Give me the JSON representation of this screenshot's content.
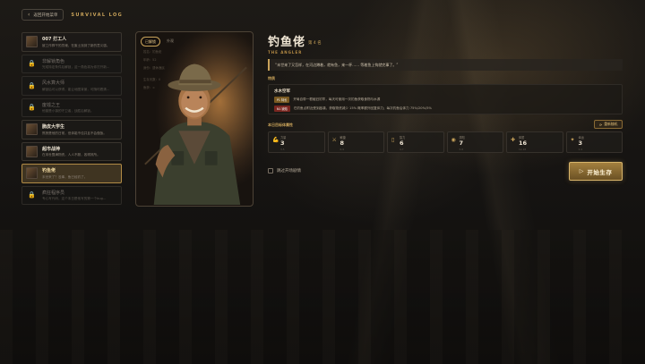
{
  "header": {
    "back_label": "返回开始菜单",
    "log_title": "SURVIVAL LOG"
  },
  "sidebar": {
    "items": [
      {
        "name": "007 打工人",
        "desc": "被工作榨干的灵魂，在废土找到了新的意义感。",
        "state": "normal"
      },
      {
        "name": "非解锁角色",
        "desc": "完成特定条件后解锁，这一角色将为你打开新…",
        "state": "locked"
      },
      {
        "name": "风水算大师",
        "desc": "解锁后可以获得，能让地图背景，可随时看清…",
        "state": "locked"
      },
      {
        "name": "废墟之王",
        "desc": "他曾是小镇的守卫者，战胜后解锁。",
        "state": "locked"
      },
      {
        "name": "脆皮大学生",
        "desc": "熬夜是他的日常，但体能不佳并且不会做饭。",
        "state": "normal"
      },
      {
        "name": "超市战神",
        "desc": "在末世囤满物资，人人不服，各得其所。",
        "state": "normal"
      },
      {
        "name": "钓鱼佬",
        "desc": "末世来了？没事，鱼已经钓了。",
        "state": "active"
      },
      {
        "name": "疯狂程序员",
        "desc": "专心写代码，这个末日是他写的第一个bug…",
        "state": "locked"
      }
    ]
  },
  "portrait": {
    "tab_on": "已解锁",
    "tab_off": "外观",
    "notes": [
      "姓名：钓鱼佬",
      "年龄：52",
      "身份：退休渔民",
      "",
      "生存天数：0",
      "鱼获：∞"
    ]
  },
  "character": {
    "name": "钓鱼佬",
    "number": "第 4 名",
    "en_name": "THE ANGLER",
    "quote": "“末世来了又怎样，在河边蹲着，就有鱼，来一杯……  等着鱼上钩就完事了。”"
  },
  "trait": {
    "section_label": "特质",
    "title": "水木空军",
    "positive_tag": "P1 特长",
    "positive_text": "开局自带一根破旧钓竿，每天可使用一次钓鱼获取食物与水源",
    "negative_tag": "N1 缺陷",
    "negative_text": "在钓鱼点附近受到敌袭，获取物资减少 15% 概率额外回复体力；每次钓鱼后体力 75%/20%/5%"
  },
  "attributes": {
    "header": "本日目标体属性",
    "reroll_label": "重新随机",
    "stats": [
      {
        "icon": "arm-icon",
        "glyph": "💪",
        "label": "力量",
        "value": "3",
        "sub": "3-5"
      },
      {
        "icon": "knife-icon",
        "glyph": "⚔",
        "label": "敏捷",
        "value": "8",
        "sub": "6-9"
      },
      {
        "icon": "book-icon",
        "glyph": "▯",
        "label": "智力",
        "value": "6",
        "sub": "4-7"
      },
      {
        "icon": "eye-icon",
        "glyph": "◉",
        "label": "感知",
        "value": "7",
        "sub": "5-8"
      },
      {
        "icon": "heart-icon",
        "glyph": "✚",
        "label": "体质",
        "value": "16",
        "sub": "12-18"
      },
      {
        "icon": "star-icon",
        "glyph": "✦",
        "label": "幸运",
        "value": "3",
        "sub": "1-4"
      }
    ]
  },
  "options": {
    "skip_label": "跳过开场剧情",
    "skip_checked": false
  },
  "start_button": {
    "label": "开始生存"
  },
  "colors": {
    "accent": "#c9a35a",
    "background": "#141210",
    "negative": "#7a2620"
  }
}
